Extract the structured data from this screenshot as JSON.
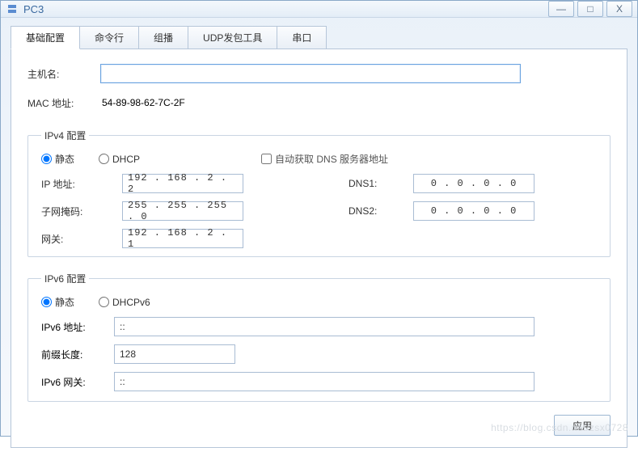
{
  "window": {
    "title": "PC3",
    "controls": {
      "min": "—",
      "max": "□",
      "close": "X"
    }
  },
  "tabs": [
    {
      "id": "basic",
      "label": "基础配置",
      "active": true
    },
    {
      "id": "cmd",
      "label": "命令行",
      "active": false
    },
    {
      "id": "mcast",
      "label": "组播",
      "active": false
    },
    {
      "id": "udp",
      "label": "UDP发包工具",
      "active": false
    },
    {
      "id": "serial",
      "label": "串口",
      "active": false
    }
  ],
  "basic": {
    "hostname_label": "主机名:",
    "hostname_value": "",
    "mac_label": "MAC 地址:",
    "mac_value": "54-89-98-62-7C-2F"
  },
  "ipv4": {
    "legend": "IPv4 配置",
    "mode_static_label": "静态",
    "mode_dhcp_label": "DHCP",
    "mode": "static",
    "auto_dns_label": "自动获取 DNS 服务器地址",
    "auto_dns_checked": false,
    "ip_label": "IP 地址:",
    "ip_value": "192 . 168 .  2  .  2",
    "mask_label": "子网掩码:",
    "mask_value": "255 . 255 . 255 .  0",
    "gw_label": "网关:",
    "gw_value": "192 . 168 .  2  .  1",
    "dns1_label": "DNS1:",
    "dns1_value": "0  .  0  .  0  .  0",
    "dns2_label": "DNS2:",
    "dns2_value": "0  .  0  .  0  .  0"
  },
  "ipv6": {
    "legend": "IPv6 配置",
    "mode_static_label": "静态",
    "mode_dhcp_label": "DHCPv6",
    "mode": "static",
    "addr_label": "IPv6 地址:",
    "addr_value": "::",
    "prefix_label": "前缀长度:",
    "prefix_value": "128",
    "gw_label": "IPv6 网关:",
    "gw_value": "::"
  },
  "footer": {
    "apply_label": "应用"
  },
  "watermark": "https://blog.csdn.net/zsx0728"
}
